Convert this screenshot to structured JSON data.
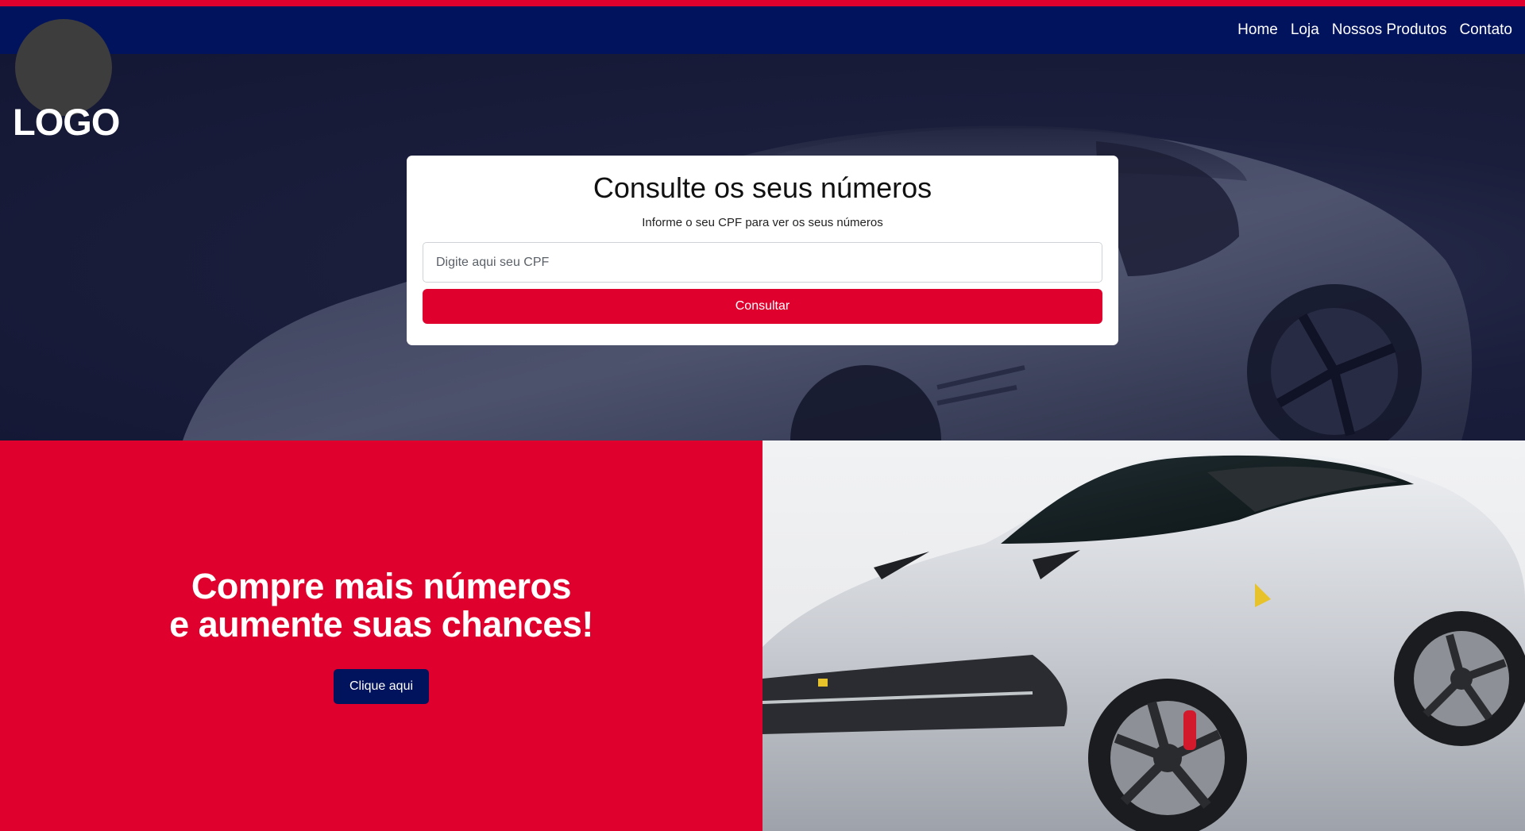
{
  "colors": {
    "accent_red": "#e0002d",
    "navy": "#02135e",
    "hero_bg": "#1a1e3b"
  },
  "header": {
    "logo_text": "LOGO",
    "nav": [
      {
        "label": "Home"
      },
      {
        "label": "Loja"
      },
      {
        "label": "Nossos Produtos"
      },
      {
        "label": "Contato"
      }
    ]
  },
  "consult": {
    "title": "Consulte os seus números",
    "subtitle": "Informe o seu CPF para ver os seus números",
    "input_placeholder": "Digite aqui seu CPF",
    "input_value": "",
    "button_label": "Consultar"
  },
  "promo": {
    "heading_line1": "Compre mais números",
    "heading_line2": "e aumente suas chances!",
    "button_label": "Clique aqui"
  },
  "images": {
    "hero_background": "car-silhouette",
    "promo_photo": "silver-sports-car"
  }
}
